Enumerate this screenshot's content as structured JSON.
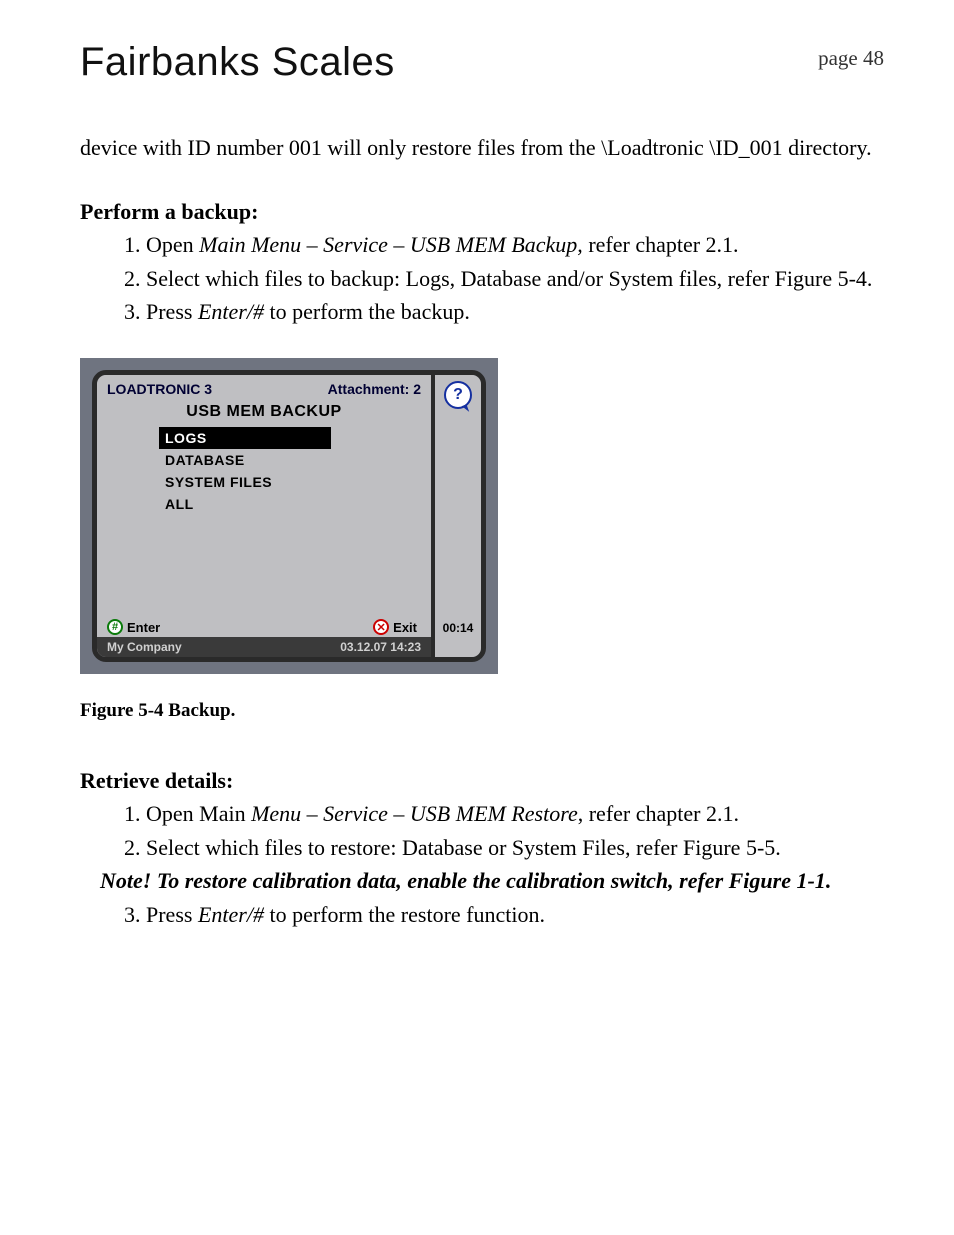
{
  "header": {
    "brand": "Fairbanks Scales",
    "page_label": "page 48"
  },
  "intro_paragraph": "device with ID number 001 will only restore files from the \\Loadtronic \\ID_001 directory.",
  "backup_section": {
    "title": "Perform a backup:",
    "step1_a": "Open ",
    "step1_b": "Main Menu – Service – USB MEM Backup,",
    "step1_c": " refer chapter 2.1.",
    "step2": "Select which files to backup: Logs, Database and/or System files, refer Figure 5-4.",
    "step3_a": "Press ",
    "step3_b": "Enter/#",
    "step3_c": " to perform the backup."
  },
  "device": {
    "product": "LOADTRONIC 3",
    "attachment": "Attachment: 2",
    "title": "USB MEM BACKUP",
    "menu": {
      "item0": "LOGS",
      "item1": "DATABASE",
      "item2": "SYSTEM FILES",
      "item3": "ALL"
    },
    "enter_label": "Enter",
    "exit_label": "Exit",
    "company": "My Company",
    "datetime": "03.12.07 14:23",
    "side_time": "00:14",
    "help_char": "?"
  },
  "figure_caption": "Figure 5-4 Backup.",
  "retrieve_section": {
    "title": "Retrieve details:",
    "step1_a": "Open Main ",
    "step1_b": "Menu – Service – USB MEM Restore",
    "step1_c": ", refer chapter 2.1.",
    "step2": "Select which files to restore: Database or System Files, refer Figure 5-5.",
    "note": "Note! To restore calibration data, enable the calibration switch, refer Figure 1-1",
    "note_period": ".",
    "step3_a": "Press ",
    "step3_b": "Enter/#",
    "step3_c": " to perform the restore function."
  }
}
